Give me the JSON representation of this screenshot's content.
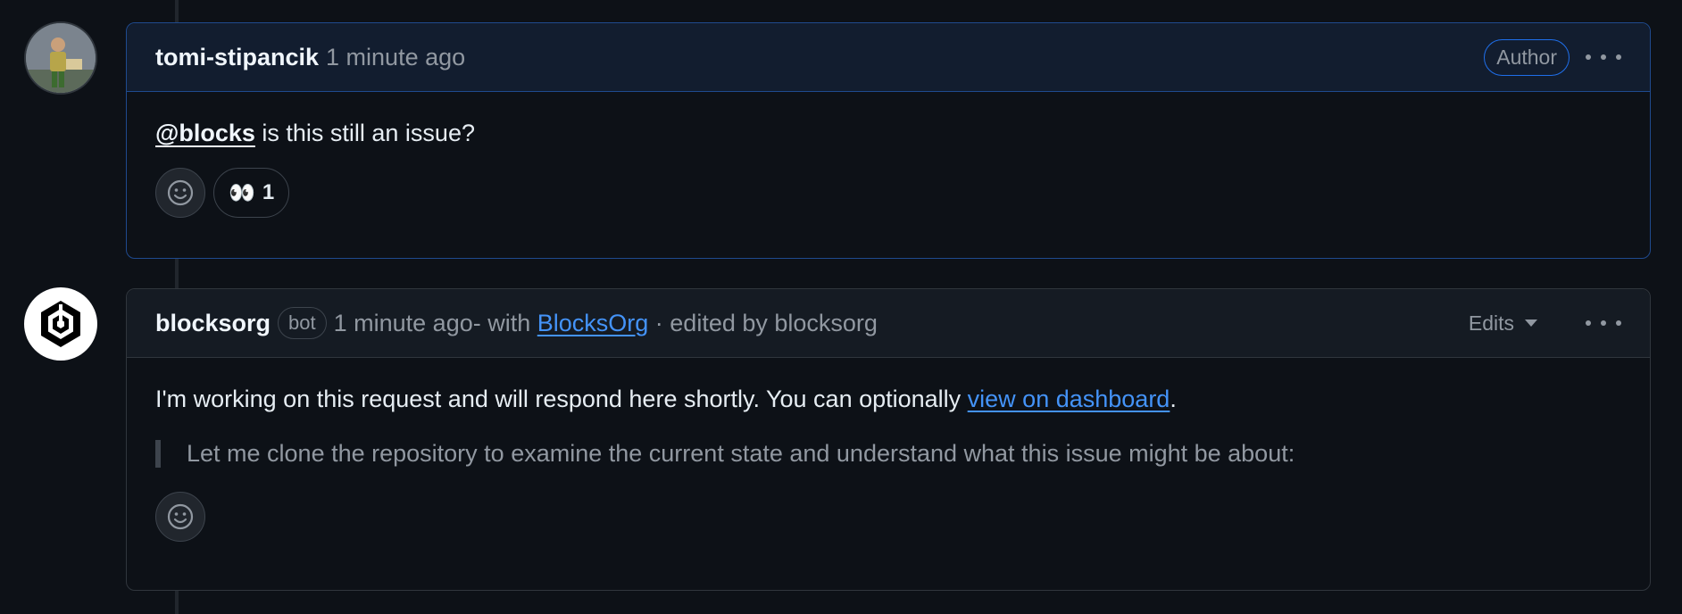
{
  "comments": [
    {
      "author": "tomi-stipancik",
      "timestamp": "1 minute ago",
      "badge": "Author",
      "body": {
        "mention": "@blocks",
        "text": " is this still an issue?"
      },
      "reactions": [
        {
          "emoji": "👀",
          "count": "1"
        }
      ]
    },
    {
      "author": "blocksorg",
      "bot_label": "bot",
      "timestamp": "1 minute ago",
      "with_prefix": "- with ",
      "app_link": "BlocksOrg",
      "edited_text": " · edited by blocksorg",
      "edits_label": "Edits",
      "body": {
        "text": "I'm working on this request and will respond here shortly. You can optionally ",
        "link": "view on dashboard",
        "text_end": "."
      },
      "quote": "Let me clone the repository to examine the current state and understand what this issue might be about:"
    }
  ],
  "icons": {
    "more": "kebab-horizontal-icon",
    "add_reaction": "smiley-icon",
    "caret": "triangle-down-icon"
  },
  "colors": {
    "background": "#0d1117",
    "link": "#4493f8",
    "highlight_border": "#1f4a8e",
    "muted_text": "#9198a1"
  }
}
